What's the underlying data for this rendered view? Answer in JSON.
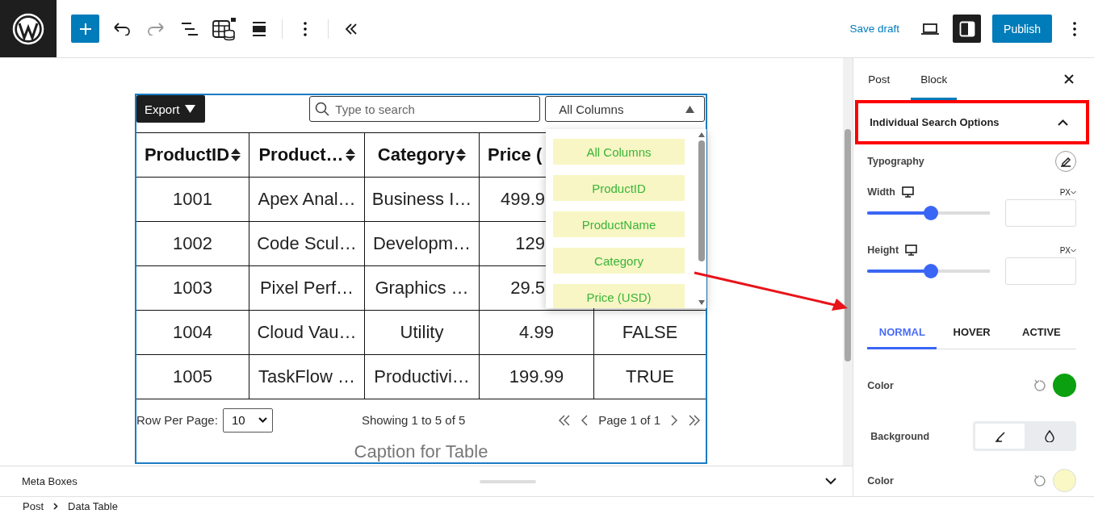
{
  "header": {
    "undo_disabled": false,
    "redo_disabled": true,
    "save_label": "Save draft",
    "sidebar_toggle_on": true,
    "publish_label": "Publish"
  },
  "table_block": {
    "export_label": "Export",
    "search_placeholder": "Type to search",
    "column_select": {
      "value": "All Columns",
      "expanded": true,
      "options": [
        {
          "label": "All Columns"
        },
        {
          "label": "ProductID"
        },
        {
          "label": "ProductName"
        },
        {
          "label": "Category"
        },
        {
          "label": "Price (USD)"
        }
      ]
    },
    "columns": [
      {
        "label": "ProductID",
        "sortable": true
      },
      {
        "label": "Product…",
        "sortable": true
      },
      {
        "label": "Category",
        "sortable": true
      },
      {
        "label": "Price (",
        "sortable": false
      }
    ],
    "rows": [
      {
        "cells": [
          "1001",
          "Apex Anal…",
          "Business I…",
          "499.9"
        ]
      },
      {
        "cells": [
          "1002",
          "Code Scul…",
          "Developm…",
          "129"
        ]
      },
      {
        "cells": [
          "1003",
          "Pixel Perf…",
          "Graphics …",
          "29.5"
        ]
      },
      {
        "cells": [
          "1004",
          "Cloud Vau…",
          "Utility",
          "4.99",
          "FALSE"
        ]
      },
      {
        "cells": [
          "1005",
          "TaskFlow …",
          "Productivi…",
          "199.99",
          "TRUE"
        ]
      }
    ],
    "rows_per_page_label": "Row Per Page:",
    "rows_per_page": "10",
    "showing": "Showing 1 to 5 of 5",
    "page_label": "Page 1 of 1",
    "caption": "Caption for Table"
  },
  "meta_boxes": {
    "label": "Meta Boxes",
    "expanded": false
  },
  "breadcrumbs": [
    "Post",
    "Data Table"
  ],
  "sidebar": {
    "tabs": [
      {
        "label": "Post",
        "selected": false
      },
      {
        "label": "Block",
        "selected": true
      }
    ],
    "panel": {
      "title": "Individual Search Options",
      "expanded": true,
      "highlighted": true
    },
    "typography_label": "Typography",
    "sliders": [
      {
        "label": "Width",
        "unit": "PX",
        "level": 0.52
      },
      {
        "label": "Height",
        "unit": "PX",
        "level": 0.52
      }
    ],
    "state_tabs": [
      {
        "label": "NORMAL",
        "selected": true
      },
      {
        "label": "HOVER",
        "selected": false
      },
      {
        "label": "ACTIVE",
        "selected": false
      }
    ],
    "text_color": {
      "label": "Color",
      "color": "#0aa00f"
    },
    "background": {
      "label": "Background",
      "modes": [
        {
          "kind": "classic",
          "selected": true
        },
        {
          "kind": "gradient",
          "selected": false
        }
      ]
    },
    "background_color": {
      "label": "Color",
      "color": "#faf8c4"
    }
  }
}
